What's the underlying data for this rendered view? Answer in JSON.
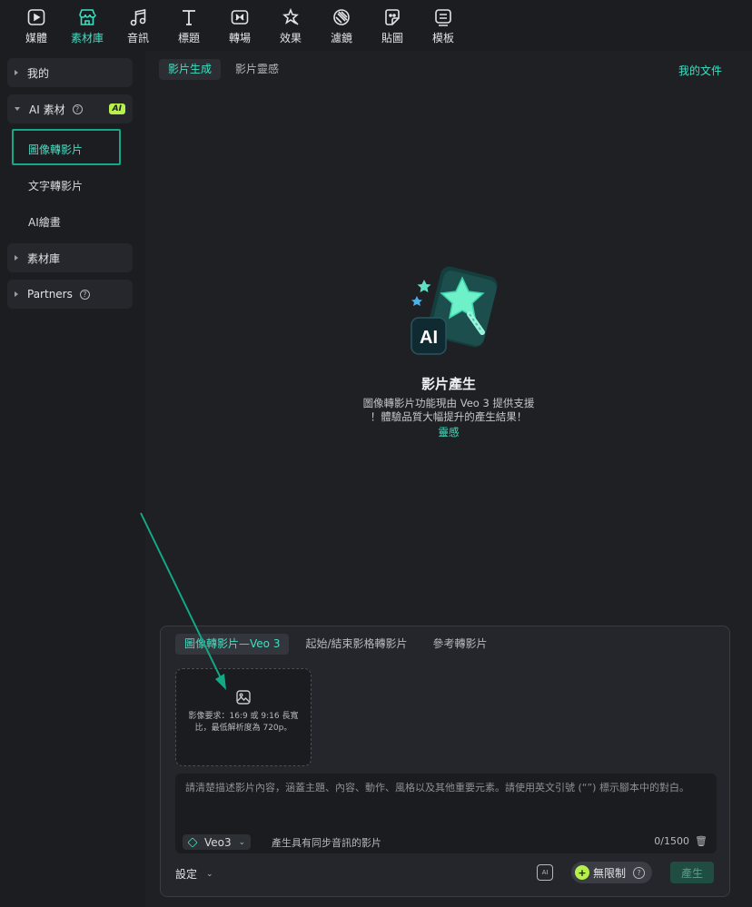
{
  "toolbar": {
    "items": [
      {
        "label": "媒體",
        "icon": "media-icon"
      },
      {
        "label": "素材庫",
        "icon": "store-icon"
      },
      {
        "label": "音訊",
        "icon": "music-icon"
      },
      {
        "label": "標題",
        "icon": "title-icon"
      },
      {
        "label": "轉場",
        "icon": "transition-icon"
      },
      {
        "label": "效果",
        "icon": "effects-icon"
      },
      {
        "label": "濾鏡",
        "icon": "filter-icon"
      },
      {
        "label": "貼圖",
        "icon": "sticker-icon"
      },
      {
        "label": "模板",
        "icon": "template-icon"
      }
    ],
    "active_index": 1
  },
  "sidebar": {
    "mine": "我的",
    "ai_assets": "AI 素材",
    "ai_badge": "AI",
    "items": [
      "圖像轉影片",
      "文字轉影片",
      "AI繪畫"
    ],
    "library": "素材庫",
    "partners": "Partners"
  },
  "main": {
    "tabs": [
      "影片生成",
      "影片靈感"
    ],
    "my_docs": "我的文件",
    "hero_title": "影片產生",
    "hero_desc_1": "圖像轉影片功能現由 Veo 3 提供支援",
    "hero_desc_2": "！體驗品質大幅提升的產生結果！",
    "hero_link": "靈感"
  },
  "card": {
    "tabs": [
      "圖像轉影片—Veo 3",
      "起始/結束影格轉影片",
      "參考轉影片"
    ],
    "upload_req": "影像要求：16:9 或 9:16 長寬比，最低解析度為 720p。",
    "prompt_placeholder": "請清楚描述影片內容，涵蓋主題、內容、動作、風格以及其他重要元素。請使用英文引號 (“”) 標示腳本中的對白。",
    "model": "Veo3",
    "sync_text": "產生具有同步音訊的影片",
    "counter": "0/1500",
    "settings": "設定",
    "unlimited": "無限制",
    "generate": "產生"
  },
  "colors": {
    "accent": "#3fe0c2",
    "ai_badge": "#b6f14a",
    "highlight_box": "#13a886"
  }
}
